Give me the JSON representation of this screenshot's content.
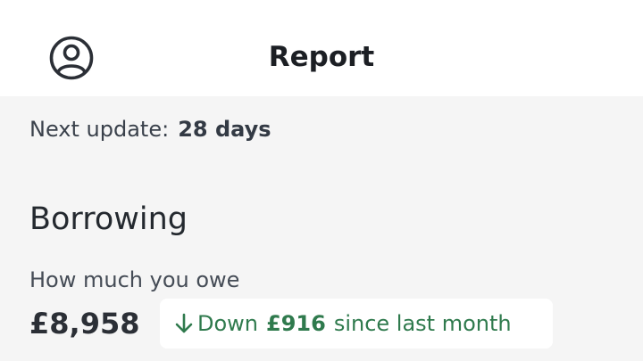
{
  "header": {
    "title": "Report",
    "profile_icon": "user-circle-icon"
  },
  "next_update": {
    "label": "Next update:",
    "value": "28 days"
  },
  "borrowing": {
    "title": "Borrowing",
    "owe_label": "How much you owe",
    "amount": "£8,958",
    "change": {
      "icon": "arrow-down-icon",
      "direction": "Down",
      "value": "£916",
      "suffix": "since last month",
      "color": "#2f7a4d"
    }
  }
}
